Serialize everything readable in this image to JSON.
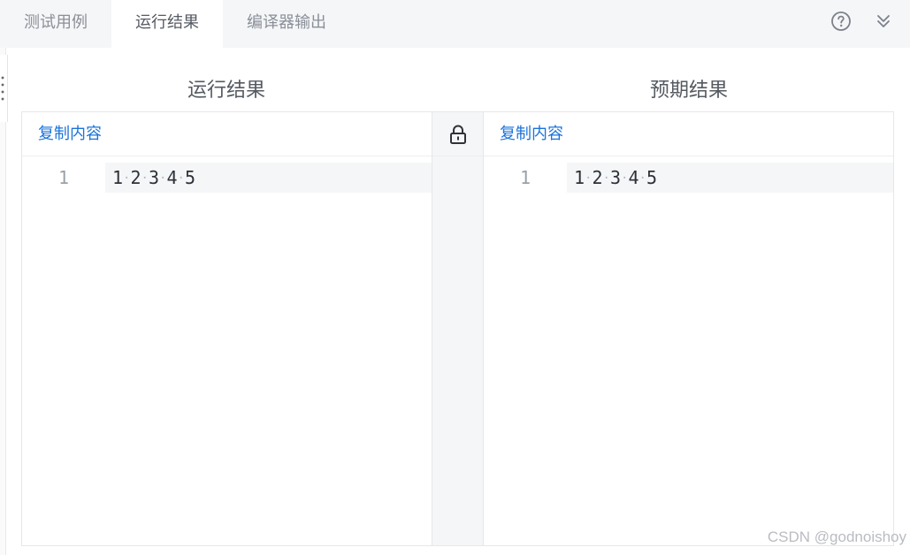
{
  "tabs": [
    {
      "label": "测试用例",
      "active": false
    },
    {
      "label": "运行结果",
      "active": true
    },
    {
      "label": "编译器输出",
      "active": false
    }
  ],
  "top_icons": [
    "help-circle-icon",
    "double-chevron-down-icon"
  ],
  "result_pane": {
    "title": "运行结果",
    "copy_label": "复制内容",
    "lines": [
      {
        "number": "1",
        "tokens": [
          "1",
          "2",
          "3",
          "4",
          "5"
        ]
      }
    ]
  },
  "expected_pane": {
    "title": "预期结果",
    "copy_label": "复制内容",
    "lines": [
      {
        "number": "1",
        "tokens": [
          "1",
          "2",
          "3",
          "4",
          "5"
        ]
      }
    ]
  },
  "sync_lock_icon": "lock-icon",
  "watermark": "CSDN @godnoishoy",
  "colors": {
    "accent": "#1a73d9",
    "tab_bar": "#f5f6f7",
    "line_highlight": "#f5f6f7"
  }
}
